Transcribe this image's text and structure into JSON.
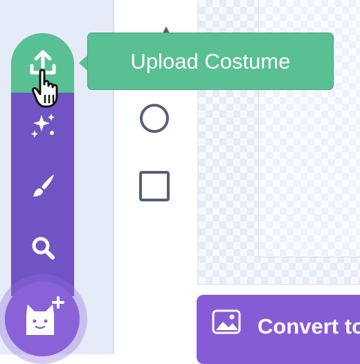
{
  "tooltip": {
    "text": "Upload Costume"
  },
  "costume_menu": {
    "items": [
      {
        "name": "upload",
        "icon": "upload-icon"
      },
      {
        "name": "surprise",
        "icon": "sparkles-icon"
      },
      {
        "name": "paint",
        "icon": "paintbrush-icon"
      },
      {
        "name": "search",
        "icon": "search-icon"
      }
    ],
    "main_button_icon": "cat-add-icon"
  },
  "tools": [
    {
      "name": "circle-tool",
      "icon": "circle-icon"
    },
    {
      "name": "rectangle-tool",
      "icon": "rectangle-icon"
    }
  ],
  "convert_button": {
    "label": "Convert to",
    "icon": "image-icon"
  },
  "colors": {
    "menu_purple": "#7153c3",
    "upload_green": "#59c093",
    "button_purple": "#855cd6",
    "tool_gray": "#575e75"
  }
}
